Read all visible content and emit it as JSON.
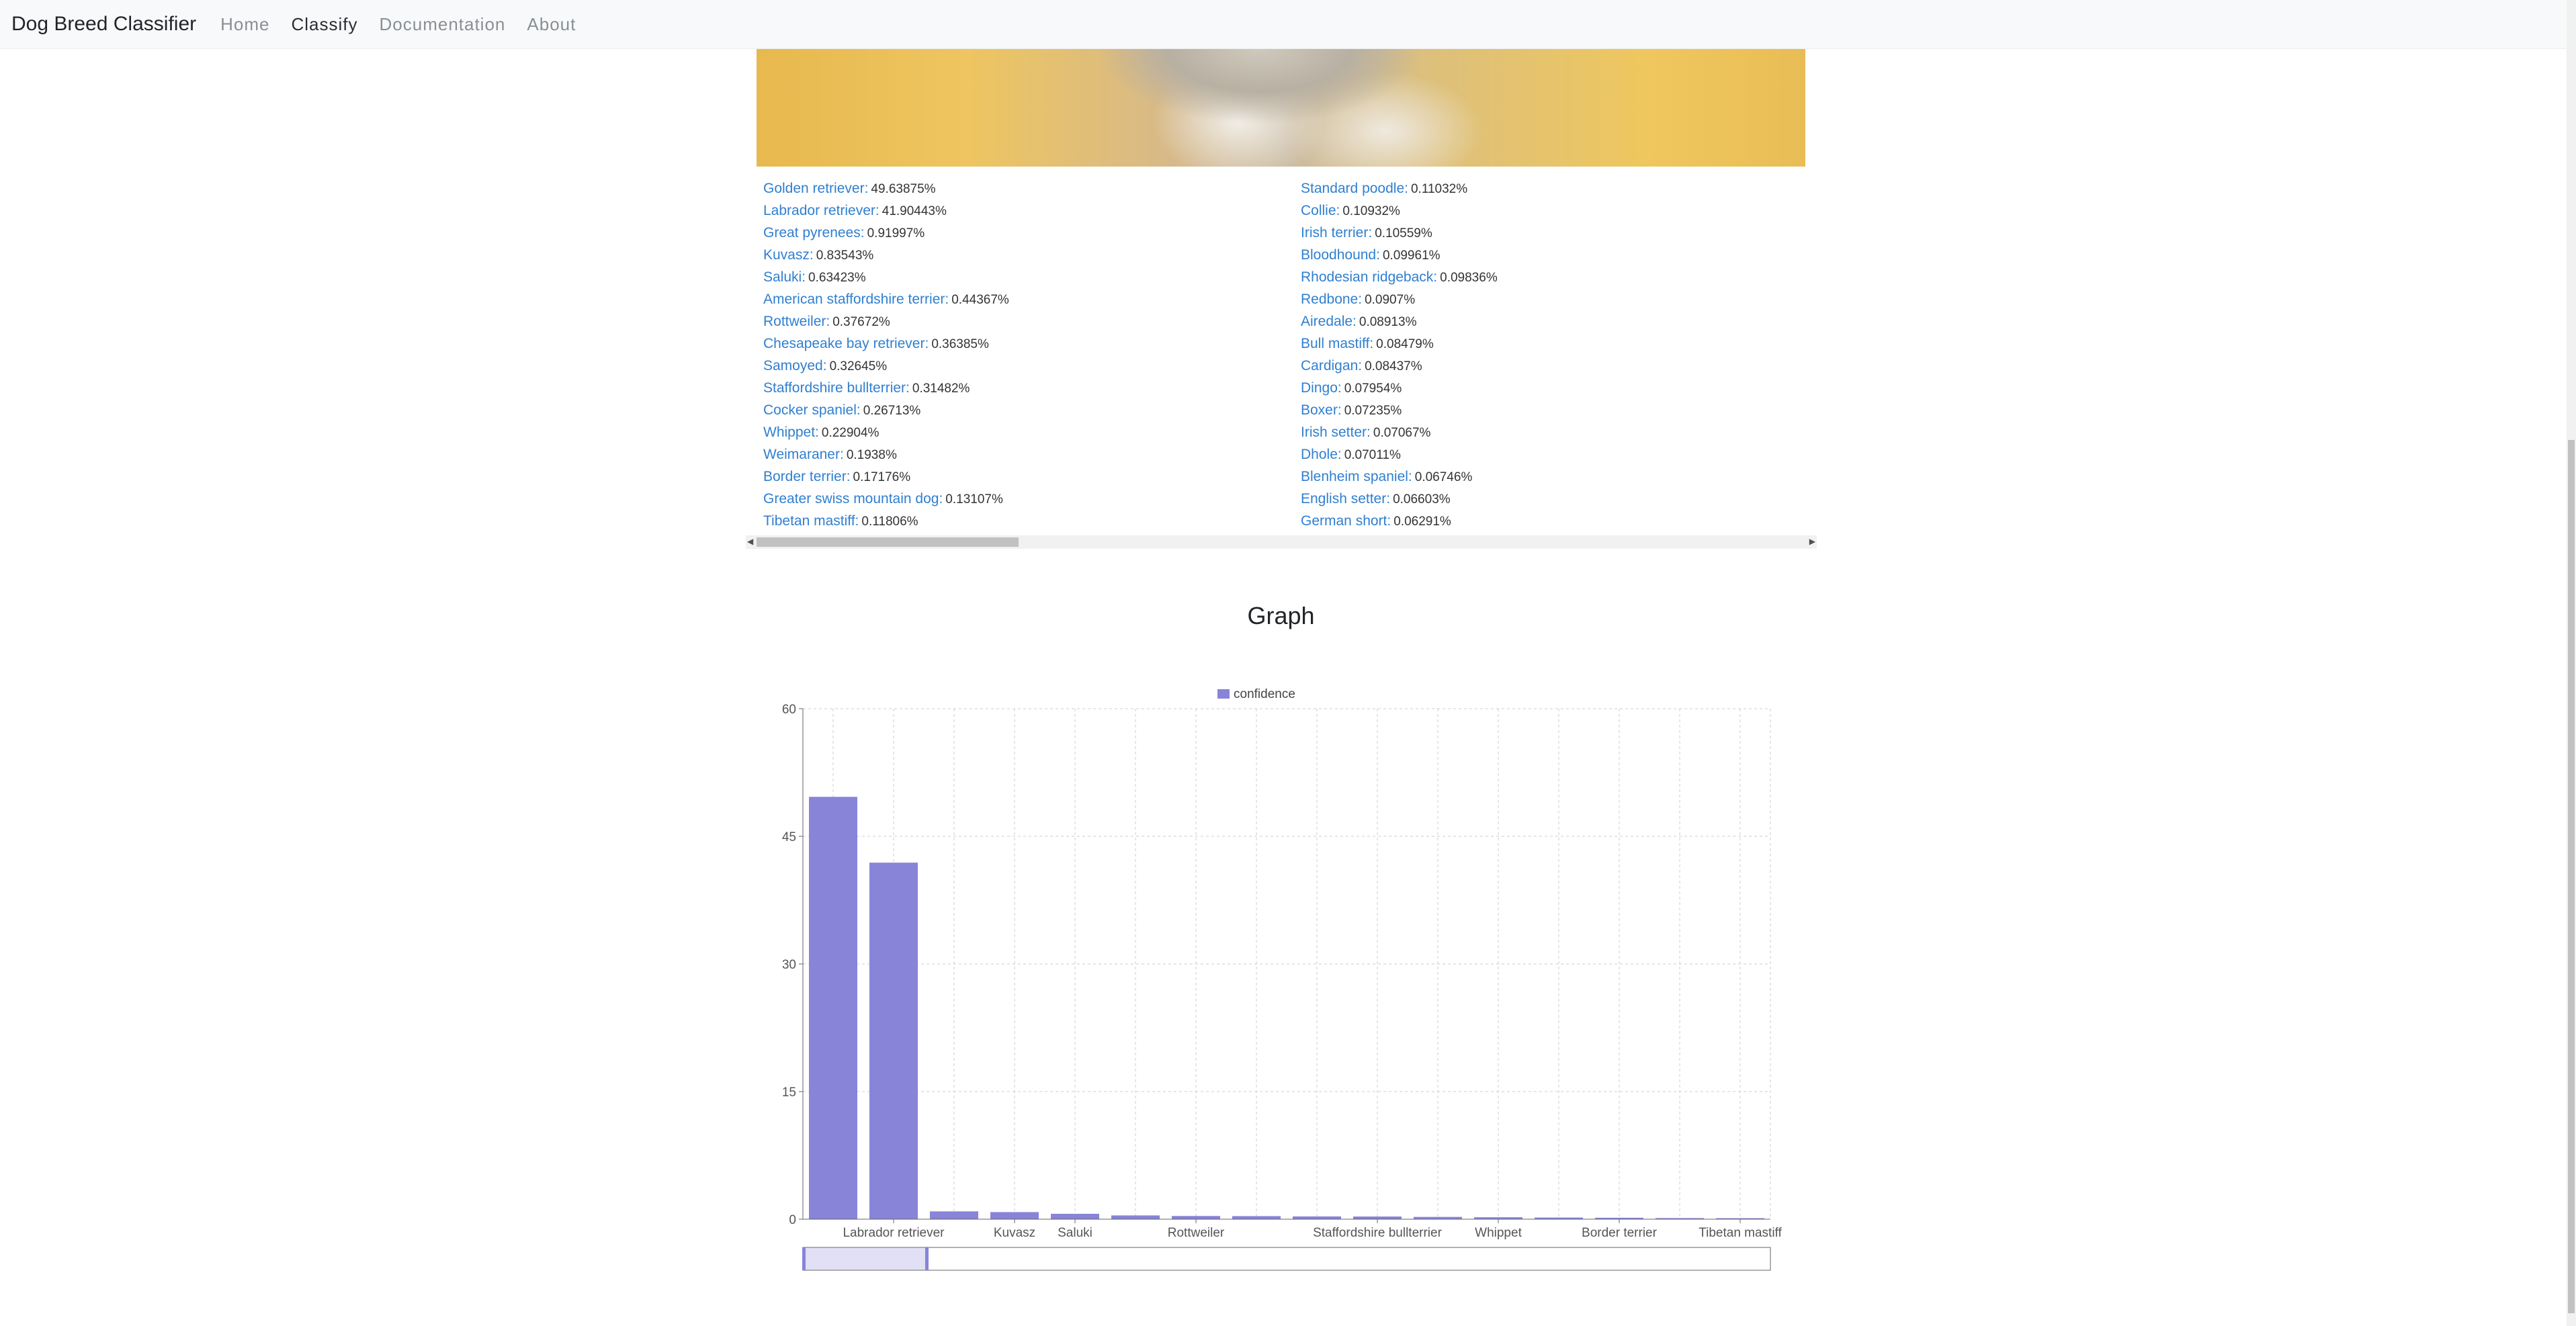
{
  "navbar": {
    "brand": "Dog Breed Classifier",
    "links": [
      "Home",
      "Classify",
      "Documentation",
      "About"
    ],
    "active": "Classify"
  },
  "predictions": {
    "left": [
      {
        "name": "Golden retriever:",
        "value": "49.63875%"
      },
      {
        "name": "Labrador retriever:",
        "value": "41.90443%"
      },
      {
        "name": "Great pyrenees:",
        "value": "0.91997%"
      },
      {
        "name": "Kuvasz:",
        "value": "0.83543%"
      },
      {
        "name": "Saluki:",
        "value": "0.63423%"
      },
      {
        "name": "American staffordshire terrier:",
        "value": "0.44367%"
      },
      {
        "name": "Rottweiler:",
        "value": "0.37672%"
      },
      {
        "name": "Chesapeake bay retriever:",
        "value": "0.36385%"
      },
      {
        "name": "Samoyed:",
        "value": "0.32645%"
      },
      {
        "name": "Staffordshire bullterrier:",
        "value": "0.31482%"
      },
      {
        "name": "Cocker spaniel:",
        "value": "0.26713%"
      },
      {
        "name": "Whippet:",
        "value": "0.22904%"
      },
      {
        "name": "Weimaraner:",
        "value": "0.1938%"
      },
      {
        "name": "Border terrier:",
        "value": "0.17176%"
      },
      {
        "name": "Greater swiss mountain dog:",
        "value": "0.13107%"
      },
      {
        "name": "Tibetan mastiff:",
        "value": "0.11806%"
      }
    ],
    "right": [
      {
        "name": "Standard poodle:",
        "value": "0.11032%"
      },
      {
        "name": "Collie:",
        "value": "0.10932%"
      },
      {
        "name": "Irish terrier:",
        "value": "0.10559%"
      },
      {
        "name": "Bloodhound:",
        "value": "0.09961%"
      },
      {
        "name": "Rhodesian ridgeback:",
        "value": "0.09836%"
      },
      {
        "name": "Redbone:",
        "value": "0.0907%"
      },
      {
        "name": "Airedale:",
        "value": "0.08913%"
      },
      {
        "name": "Bull mastiff:",
        "value": "0.08479%"
      },
      {
        "name": "Cardigan:",
        "value": "0.08437%"
      },
      {
        "name": "Dingo:",
        "value": "0.07954%"
      },
      {
        "name": "Boxer:",
        "value": "0.07235%"
      },
      {
        "name": "Irish setter:",
        "value": "0.07067%"
      },
      {
        "name": "Dhole:",
        "value": "0.07011%"
      },
      {
        "name": "Blenheim spaniel:",
        "value": "0.06746%"
      },
      {
        "name": "English setter:",
        "value": "0.06603%"
      },
      {
        "name": "German short:",
        "value": "0.06291%"
      }
    ]
  },
  "graph": {
    "heading": "Graph"
  },
  "colors": {
    "bar": "#8884d8",
    "link": "#2f7fd0",
    "grid": "#cccccc"
  },
  "chart_data": {
    "type": "bar",
    "categories": [
      "Golden retriever",
      "Labrador retriever",
      "Great pyrenees",
      "Kuvasz",
      "Saluki",
      "American staffordshire terrier",
      "Rottweiler",
      "Chesapeake bay retriever",
      "Samoyed",
      "Staffordshire bullterrier",
      "Cocker spaniel",
      "Whippet",
      "Weimaraner",
      "Border terrier",
      "Greater swiss mountain dog",
      "Tibetan mastiff"
    ],
    "visible_tick_labels": [
      "Labrador retriever",
      "Kuvasz",
      "Saluki",
      "Rottweiler",
      "Staffordshire bullterrier",
      "Whippet",
      "Border terrier",
      "Tibetan mastiff"
    ],
    "series": [
      {
        "name": "confidence",
        "values": [
          49.63875,
          41.90443,
          0.91997,
          0.83543,
          0.63423,
          0.44367,
          0.37672,
          0.36385,
          0.32645,
          0.31482,
          0.26713,
          0.22904,
          0.1938,
          0.17176,
          0.13107,
          0.11806
        ]
      }
    ],
    "ylim": [
      0,
      60
    ],
    "yticks": [
      0,
      15,
      30,
      45,
      60
    ],
    "grid": true,
    "legend": "top-center",
    "brush": true
  }
}
